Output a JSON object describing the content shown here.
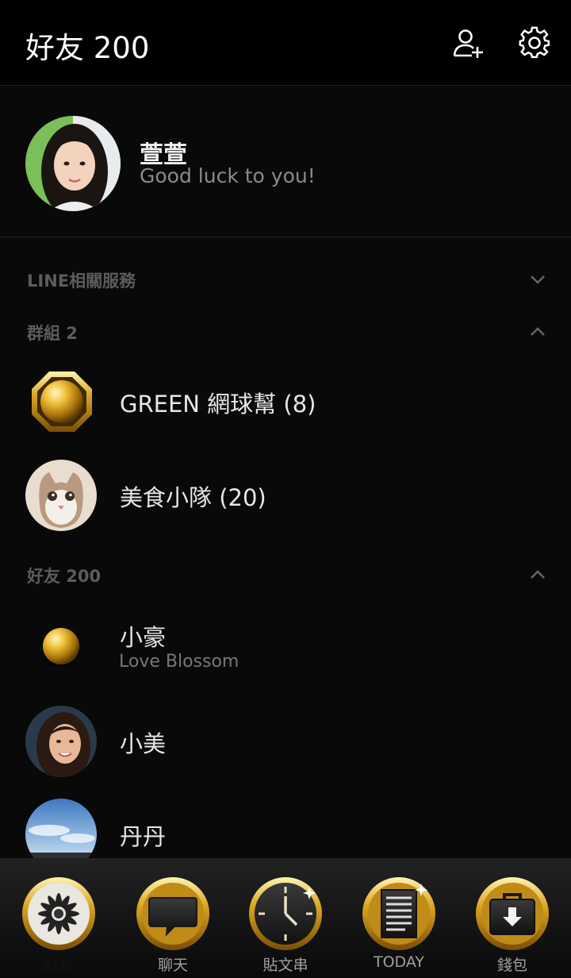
{
  "header": {
    "title": "好友 200",
    "add_friend_icon": "person-add-icon",
    "settings_icon": "gear-icon"
  },
  "profile": {
    "name": "萱萱",
    "status": "Good luck to you!"
  },
  "sections": {
    "services": "LINE相關服務",
    "groups": "群組 2",
    "friends": "好友 200"
  },
  "groups": [
    {
      "name": "GREEN 網球幫 (8)"
    },
    {
      "name": "美食小隊 (20)"
    }
  ],
  "friends": [
    {
      "name": "小豪",
      "status": "Love Blossom"
    },
    {
      "name": "小美"
    },
    {
      "name": "丹丹"
    }
  ],
  "tabs": [
    {
      "label": "好友",
      "icon": "flower-icon",
      "active": true
    },
    {
      "label": "聊天",
      "icon": "chat-bubble-icon"
    },
    {
      "label": "貼文串",
      "icon": "clock-icon"
    },
    {
      "label": "TODAY",
      "icon": "news-icon"
    },
    {
      "label": "錢包",
      "icon": "wallet-icon"
    }
  ],
  "colors": {
    "background": "#090909",
    "header": "#000000",
    "accent_gold": "#d4a017"
  }
}
